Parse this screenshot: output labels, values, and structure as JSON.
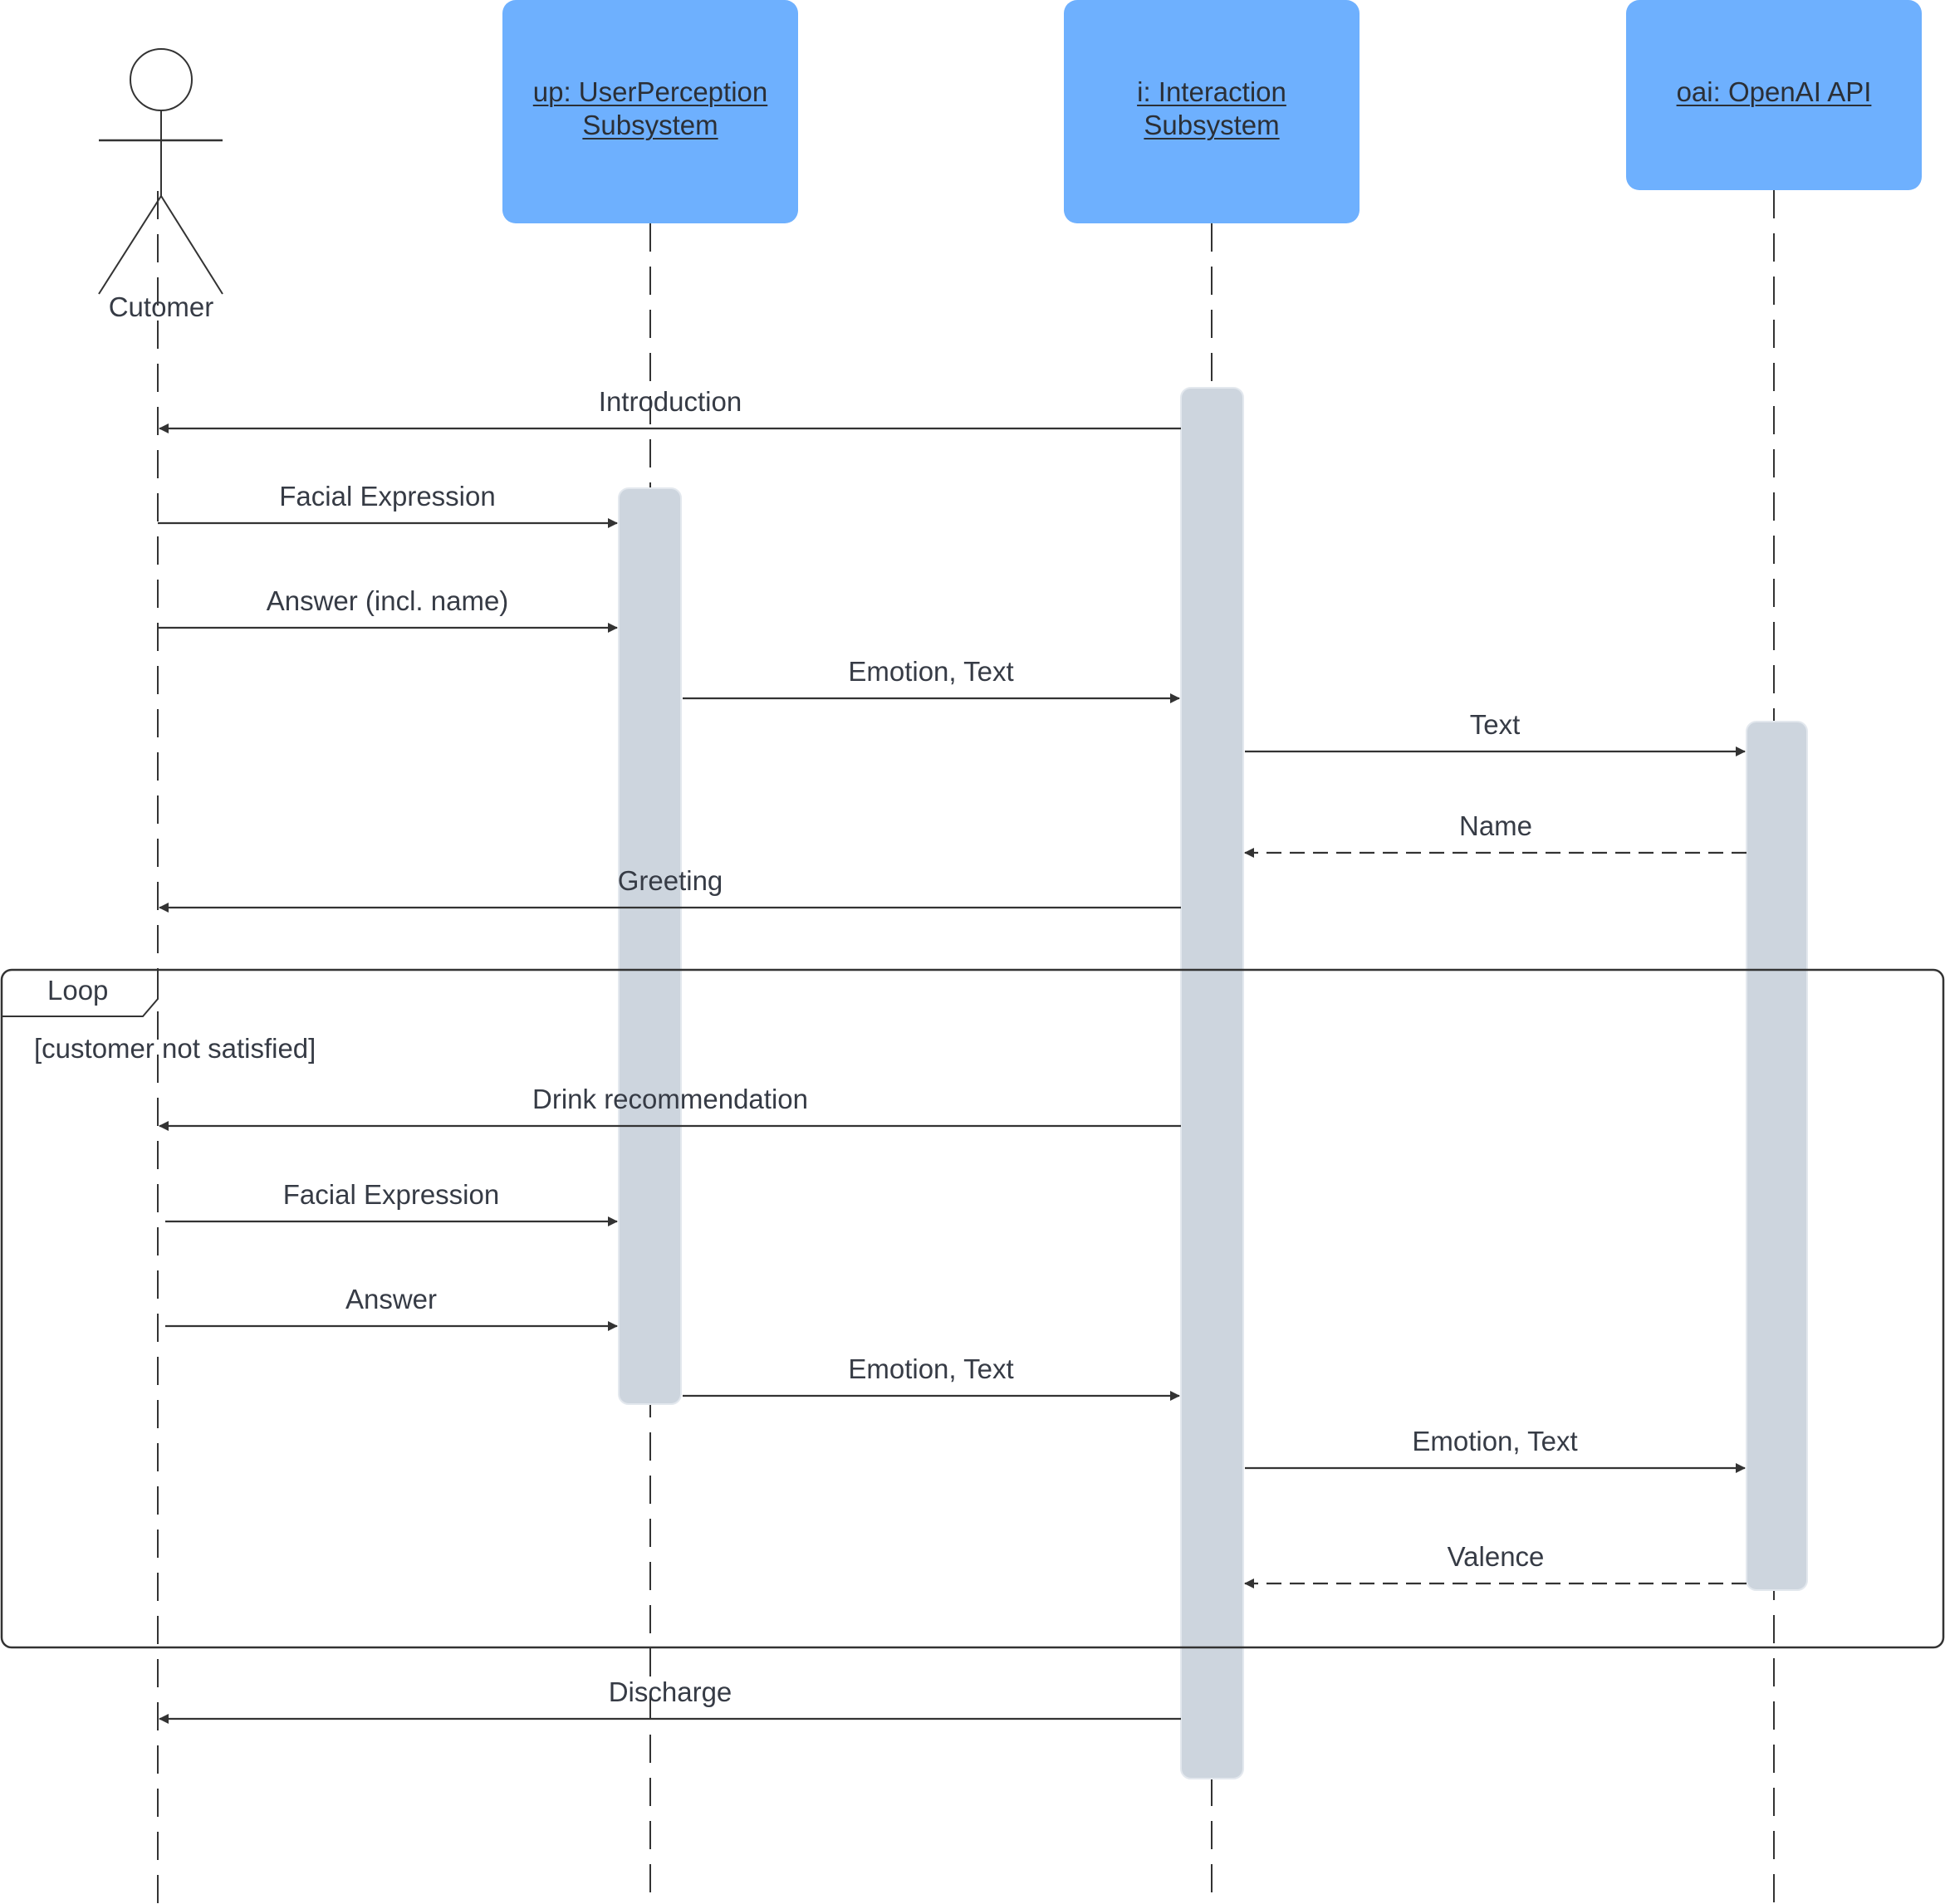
{
  "participants": [
    {
      "id": "customer",
      "kind": "actor",
      "label": "Cutomer"
    },
    {
      "id": "up",
      "kind": "object",
      "label_lines": [
        "up: UserPerception",
        "Subsystem"
      ]
    },
    {
      "id": "i",
      "kind": "object",
      "label_lines": [
        "i: Interaction",
        "Subsystem"
      ]
    },
    {
      "id": "oai",
      "kind": "object",
      "label_lines": [
        "oai: OpenAI API"
      ]
    }
  ],
  "colors": {
    "participant_fill": "#6eb0fe",
    "activation_fill": "#cdd5de",
    "line": "#333333",
    "text": "#363b45"
  },
  "messages": [
    {
      "label": "Introduction",
      "from": "i",
      "to": "customer",
      "style": "solid"
    },
    {
      "label": "Facial Expression",
      "from": "customer",
      "to": "up",
      "style": "solid"
    },
    {
      "label": "Answer (incl. name)",
      "from": "customer",
      "to": "up",
      "style": "solid"
    },
    {
      "label": "Emotion, Text",
      "from": "up",
      "to": "i",
      "style": "solid"
    },
    {
      "label": "Text",
      "from": "i",
      "to": "oai",
      "style": "solid"
    },
    {
      "label": "Name",
      "from": "oai",
      "to": "i",
      "style": "dashed"
    },
    {
      "label": "Greeting",
      "from": "i",
      "to": "customer",
      "style": "solid"
    },
    {
      "label": "Drink recommendation",
      "from": "i",
      "to": "customer",
      "style": "solid"
    },
    {
      "label": "Facial Expression",
      "from": "customer",
      "to": "up",
      "style": "solid"
    },
    {
      "label": "Answer",
      "from": "customer",
      "to": "up",
      "style": "solid"
    },
    {
      "label": "Emotion, Text",
      "from": "up",
      "to": "i",
      "style": "solid"
    },
    {
      "label": "Emotion, Text",
      "from": "i",
      "to": "oai",
      "style": "solid"
    },
    {
      "label": "Valence",
      "from": "oai",
      "to": "i",
      "style": "dashed"
    },
    {
      "label": "Discharge",
      "from": "i",
      "to": "customer",
      "style": "solid"
    }
  ],
  "loop": {
    "operator": "Loop",
    "guard": "[customer not satisfied]"
  }
}
